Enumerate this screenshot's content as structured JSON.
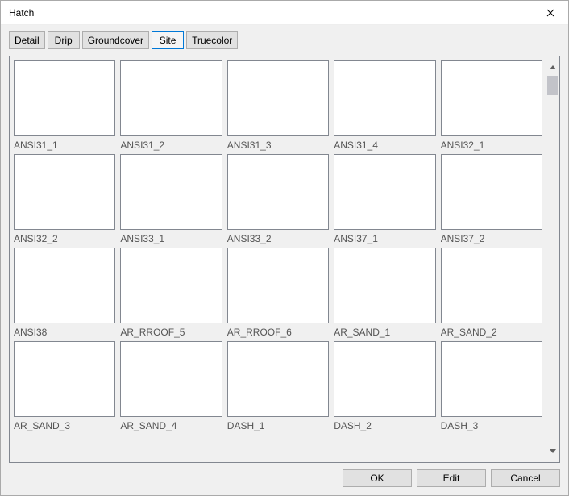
{
  "window": {
    "title": "Hatch"
  },
  "tabs": [
    {
      "label": "Detail",
      "active": false
    },
    {
      "label": "Drip",
      "active": false
    },
    {
      "label": "Groundcover",
      "active": false
    },
    {
      "label": "Site",
      "active": true
    },
    {
      "label": "Truecolor",
      "active": false
    }
  ],
  "patterns": [
    {
      "name": "ANSI31_1"
    },
    {
      "name": "ANSI31_2"
    },
    {
      "name": "ANSI31_3"
    },
    {
      "name": "ANSI31_4"
    },
    {
      "name": "ANSI32_1"
    },
    {
      "name": "ANSI32_2"
    },
    {
      "name": "ANSI33_1"
    },
    {
      "name": "ANSI33_2"
    },
    {
      "name": "ANSI37_1"
    },
    {
      "name": "ANSI37_2"
    },
    {
      "name": "ANSI38"
    },
    {
      "name": "AR_RROOF_5"
    },
    {
      "name": "AR_RROOF_6"
    },
    {
      "name": "AR_SAND_1"
    },
    {
      "name": "AR_SAND_2"
    },
    {
      "name": "AR_SAND_3"
    },
    {
      "name": "AR_SAND_4"
    },
    {
      "name": "DASH_1"
    },
    {
      "name": "DASH_2"
    },
    {
      "name": "DASH_3"
    }
  ],
  "footer": {
    "ok": "OK",
    "edit": "Edit",
    "cancel": "Cancel"
  }
}
